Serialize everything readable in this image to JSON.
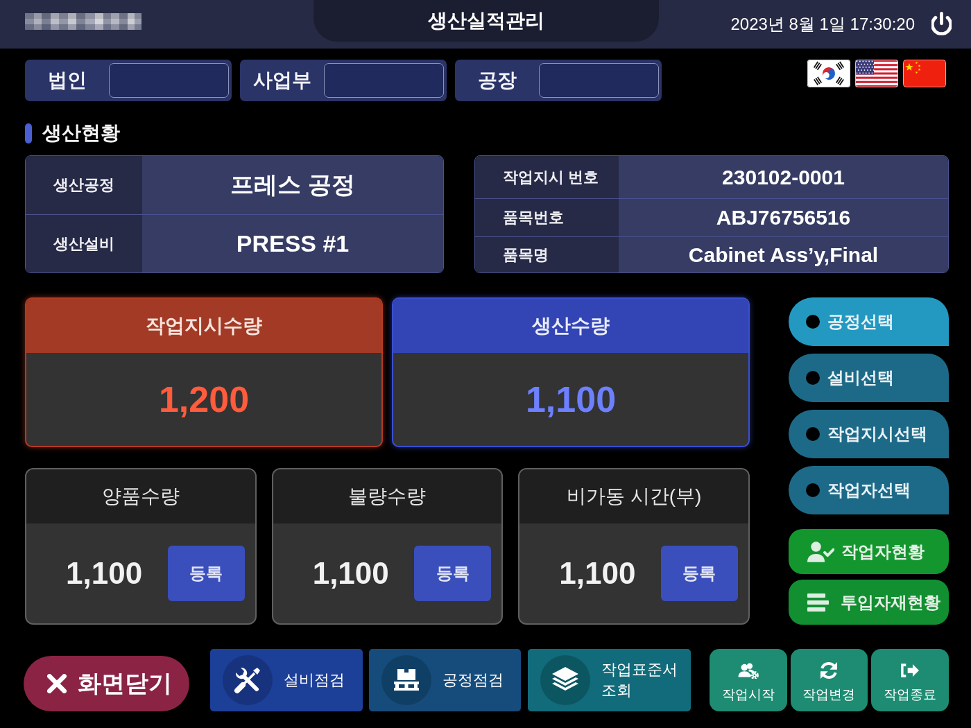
{
  "header": {
    "title": "생산실적관리",
    "datetime": "2023년 8월 1일 17:30:20"
  },
  "filters": [
    {
      "label": "법인"
    },
    {
      "label": "사업부"
    },
    {
      "label": "공장"
    }
  ],
  "section_title": "생산현황",
  "process_info": [
    {
      "label": "생산공정",
      "value": "프레스 공정"
    },
    {
      "label": "생산설비",
      "value": "PRESS #1"
    }
  ],
  "order_info": [
    {
      "label": "작업지시 번호",
      "value": "230102-0001"
    },
    {
      "label": "품목번호",
      "value": "ABJ76756516"
    },
    {
      "label": "품목명",
      "value": "Cabinet Ass’y,Final"
    }
  ],
  "main_counts": [
    {
      "kind": "order",
      "label": "작업지시수량",
      "value": "1,200"
    },
    {
      "kind": "production",
      "label": "생산수량",
      "value": "1,100"
    }
  ],
  "sub_counts": [
    {
      "label": "양품수량",
      "value": "1,100",
      "button": "등록"
    },
    {
      "label": "불량수량",
      "value": "1,100",
      "button": "등록"
    },
    {
      "label": "비가동 시간(부)",
      "value": "1,100",
      "button": "등록"
    }
  ],
  "side_menu": [
    {
      "label": "공정선택",
      "selected": true
    },
    {
      "label": "설비선택",
      "selected": false
    },
    {
      "label": "작업지시선택",
      "selected": false
    },
    {
      "label": "작업자선택",
      "selected": false
    }
  ],
  "status_buttons": [
    {
      "label": "작업자현황"
    },
    {
      "label": "투입자재현황"
    }
  ],
  "close_button": {
    "label": "화면닫기"
  },
  "check_buttons": [
    {
      "label": "설비점검"
    },
    {
      "label": "공정점검"
    },
    {
      "label": "작업표준서 조회"
    }
  ],
  "work_buttons": [
    {
      "label": "작업시작"
    },
    {
      "label": "작업변경"
    },
    {
      "label": "작업종료"
    }
  ]
}
